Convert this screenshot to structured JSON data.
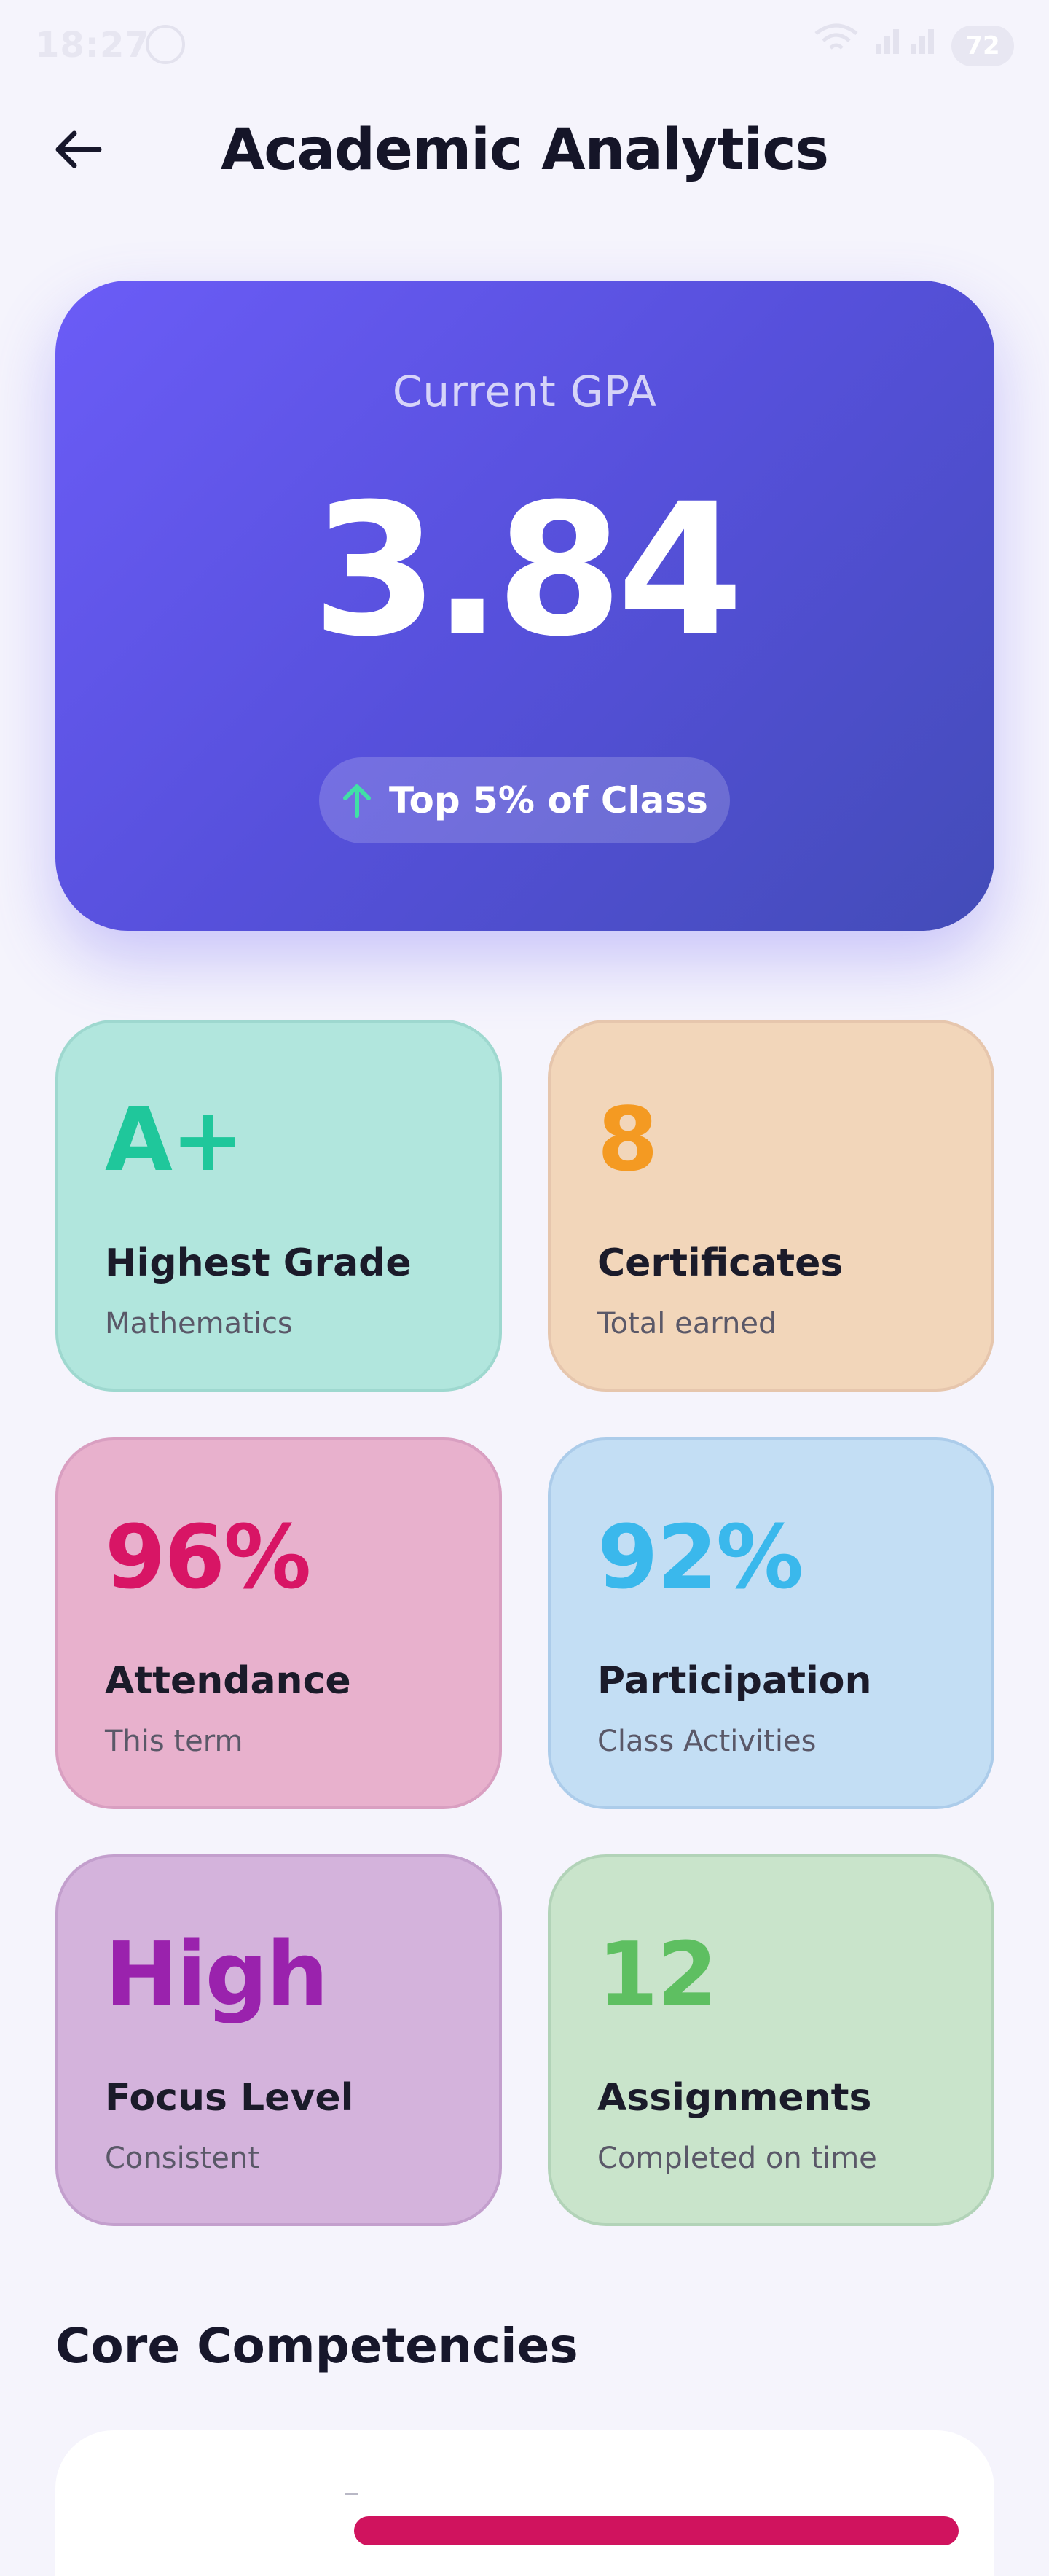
{
  "status_bar": {
    "time": "18:27",
    "battery": "72"
  },
  "header": {
    "title": "Academic Analytics"
  },
  "gpa": {
    "label": "Current GPA",
    "value": "3.84",
    "badge": "Top 5% of Class"
  },
  "stats": [
    {
      "value": "A+",
      "title": "Highest Grade",
      "subtitle": "Mathematics",
      "color": "#1fc79b"
    },
    {
      "value": "8",
      "title": "Certificates",
      "subtitle": "Total earned",
      "color": "#f49a22"
    },
    {
      "value": "96%",
      "title": "Attendance",
      "subtitle": "This term",
      "color": "#d81565"
    },
    {
      "value": "92%",
      "title": "Participation",
      "subtitle": "Class Activities",
      "color": "#3ab8ec"
    },
    {
      "value": "High",
      "title": "Focus Level",
      "subtitle": "Consistent",
      "color": "#9a22ad"
    },
    {
      "value": "12",
      "title": "Assignments",
      "subtitle": "Completed on time",
      "color": "#5ebf61"
    }
  ],
  "competencies": {
    "title": "Core Competencies"
  },
  "colors": {
    "accent": "#6b5cf7",
    "gpa_gradient_end": "#434cb8",
    "trend_up": "#41e0a6"
  }
}
